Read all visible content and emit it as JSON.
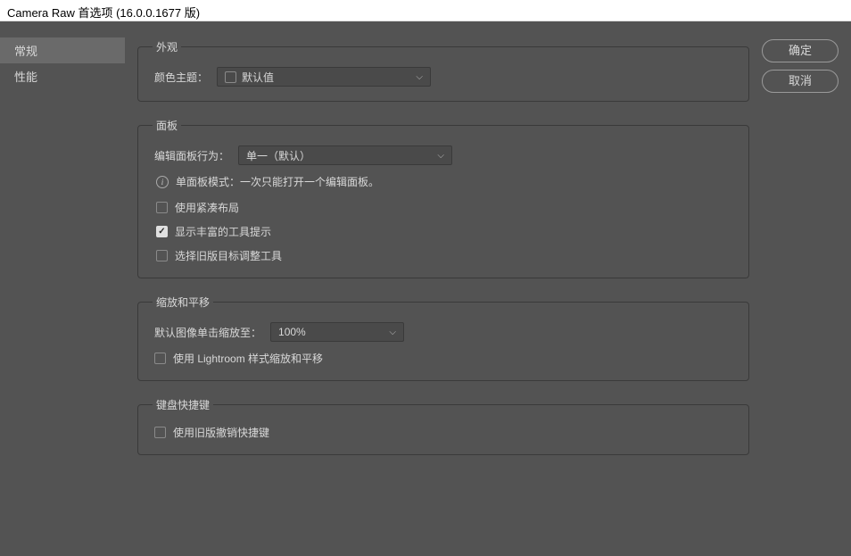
{
  "window": {
    "title": "Camera Raw 首选项  (16.0.0.1677 版)"
  },
  "sidebar": {
    "items": [
      {
        "label": "常规"
      },
      {
        "label": "性能"
      }
    ]
  },
  "buttons": {
    "ok": "确定",
    "cancel": "取消"
  },
  "appearance": {
    "legend": "外观",
    "theme_label": "颜色主题：",
    "theme_value": "默认值"
  },
  "panel": {
    "legend": "面板",
    "behavior_label": "编辑面板行为：",
    "behavior_value": "单一（默认）",
    "info_text": "单面板模式：一次只能打开一个编辑面板。",
    "compact_label": "使用紧凑布局",
    "richtips_label": "显示丰富的工具提示",
    "legacy_label": "选择旧版目标调整工具"
  },
  "zoom": {
    "legend": "缩放和平移",
    "click_label": "默认图像单击缩放至：",
    "click_value": "100%",
    "lightroom_label": "使用 Lightroom 样式缩放和平移"
  },
  "shortcut": {
    "legend": "键盘快捷键",
    "legacy_undo_label": "使用旧版撤销快捷键"
  }
}
